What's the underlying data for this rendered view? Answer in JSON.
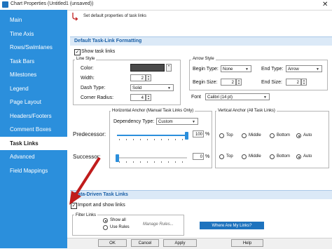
{
  "window": {
    "title": "Chart Properties (Untitled1 (unsaved))",
    "close": "✕"
  },
  "sidebar": {
    "items": [
      "Main",
      "Time Axis",
      "Rows/Swimlanes",
      "Task Bars",
      "Milestones",
      "Legend",
      "Page Layout",
      "Headers/Footers",
      "Comment Boxes",
      "Task Links",
      "Advanced",
      "Field Mappings"
    ],
    "active_index": 9
  },
  "header": {
    "text": "Set default properties of task links"
  },
  "section_default": {
    "title": "Default Task-Link Formatting",
    "show_task_links_label": "Show task links",
    "show_task_links_checked": true,
    "line_style": {
      "group_label": "Line Style",
      "color_label": "Color:",
      "color_value": "#4a4a4a",
      "width_label": "Width:",
      "width_value": "2",
      "dash_label": "Dash Type:",
      "dash_value": "Solid",
      "radius_label": "Corner Radius:",
      "radius_value": "4"
    },
    "arrow_style": {
      "group_label": "Arrow Style",
      "begin_type_label": "Begin Type:",
      "begin_type_value": "None",
      "end_type_label": "End Type:",
      "end_type_value": "Arrow",
      "begin_size_label": "Begin Size:",
      "begin_size_value": "2",
      "end_size_label": "End Size:",
      "end_size_value": "2"
    },
    "font_label": "Font",
    "font_value": "Calibri (14 pt)",
    "horizontal_anchor": {
      "group_label": "Horizontal Anchor (Manual Task Links Only)",
      "dep_type_label": "Dependency Type:",
      "dep_type_value": "Custom",
      "predecessor_label": "Predecessor:",
      "predecessor_value": "100",
      "predecessor_fraction": 1.0,
      "successor_label": "Successor:",
      "successor_value": "0",
      "successor_fraction": 0.0,
      "percent": "%"
    },
    "vertical_anchor": {
      "group_label": "Vertical Anchor (All Task Links)",
      "options": [
        "Top",
        "Middle",
        "Bottom",
        "Auto"
      ],
      "predecessor_selected": "Auto",
      "successor_selected": "Auto"
    }
  },
  "section_data": {
    "title": "Data-Driven Task Links",
    "import_label": "Import and show links",
    "import_checked": true,
    "filter_group_label": "Filter Links",
    "show_all_label": "Show all",
    "use_rules_label": "Use Rules",
    "filter_selected": "Show all",
    "manage_rules_label": "Manage Rules...",
    "help_button": "Where Are My Links?"
  },
  "footer": {
    "ok": "OK",
    "cancel": "Cancel",
    "apply": "Apply",
    "help": "Help"
  },
  "colors": {
    "accent": "#2b8fdc",
    "arrow": "#c01c1c"
  }
}
